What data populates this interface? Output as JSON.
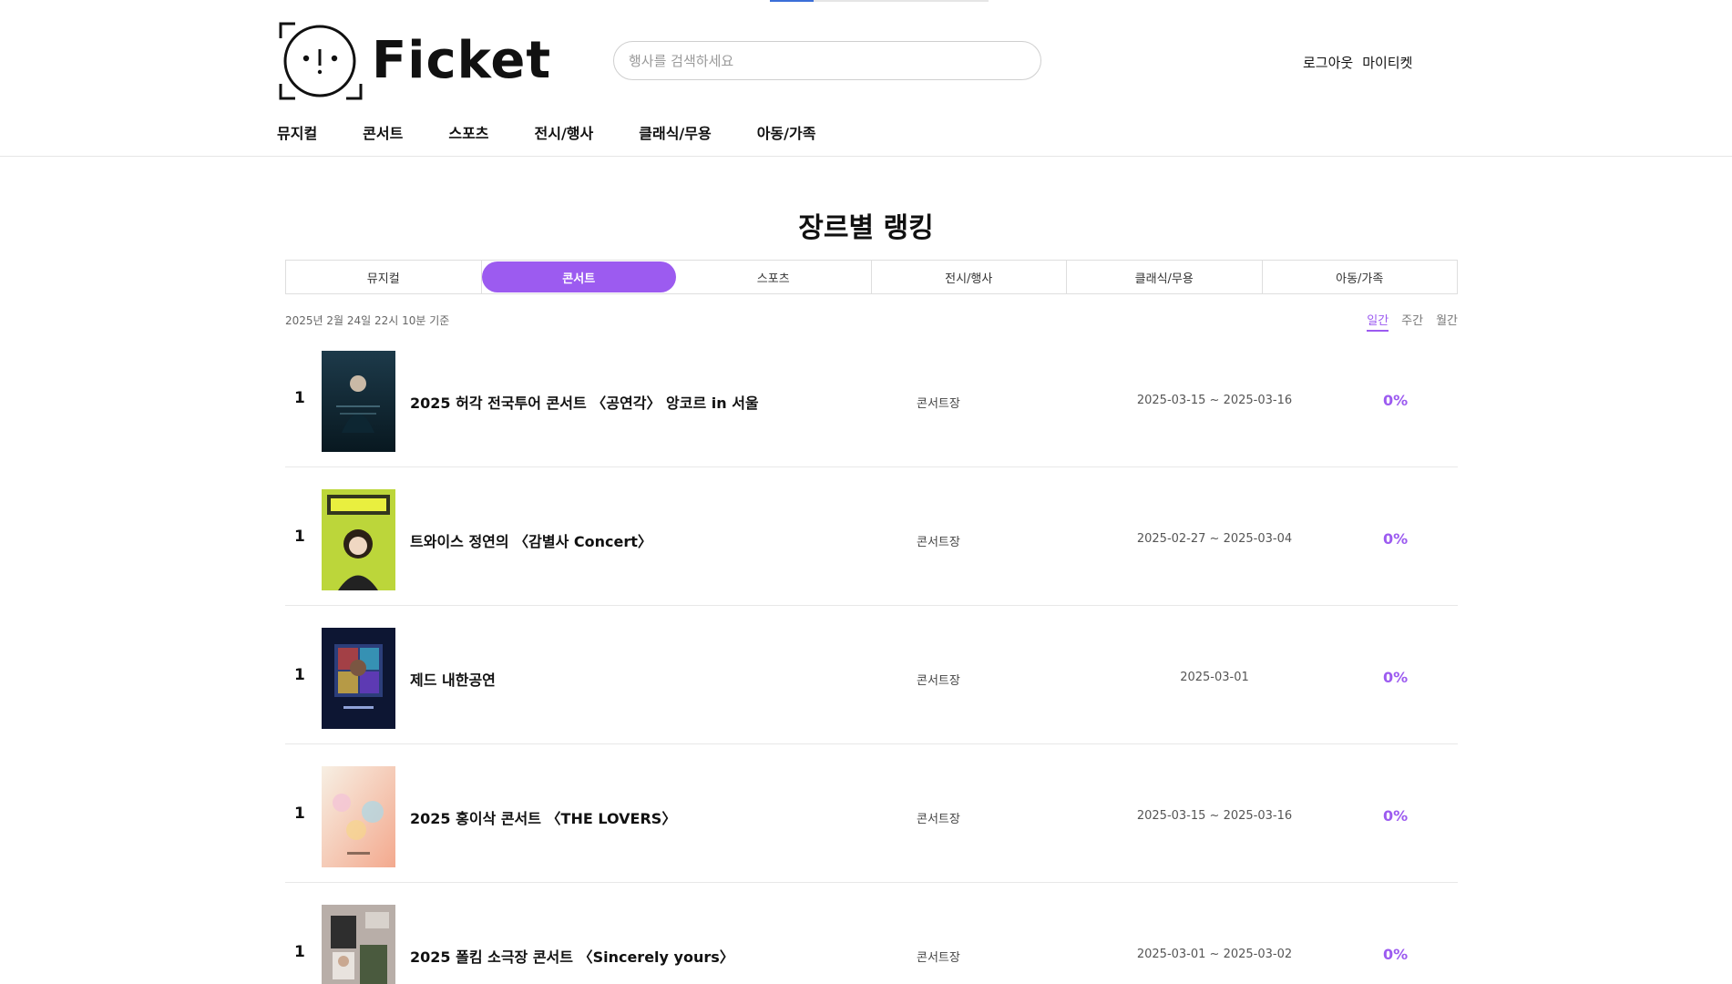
{
  "header": {
    "logo_text": "Ficket",
    "search_placeholder": "행사를 검색하세요",
    "logout": "로그아웃",
    "my_ticket": "마이티켓",
    "nav": [
      "뮤지컬",
      "콘서트",
      "스포츠",
      "전시/행사",
      "클래식/무용",
      "아동/가족"
    ]
  },
  "page": {
    "title": "장르별 랭킹",
    "genre_tabs": [
      "뮤지컬",
      "콘서트",
      "스포츠",
      "전시/행사",
      "클래식/무용",
      "아동/가족"
    ],
    "active_genre": "콘서트",
    "timestamp": "2025년 2월 24일 22시 10분 기준",
    "period_tabs": [
      "일간",
      "주간",
      "월간"
    ],
    "active_period": "일간"
  },
  "rankings": [
    {
      "rank": "1",
      "title": "2025 허각 전국투어 콘서트 〈공연각〉 앙코르 in 서울",
      "venue": "콘서트장",
      "date": "2025-03-15 ~ 2025-03-16",
      "rate": "0%"
    },
    {
      "rank": "1",
      "title": "트와이스 정연의 〈감별사 Concert〉",
      "venue": "콘서트장",
      "date": "2025-02-27 ~ 2025-03-04",
      "rate": "0%"
    },
    {
      "rank": "1",
      "title": "제드 내한공연",
      "venue": "콘서트장",
      "date": "2025-03-01",
      "rate": "0%"
    },
    {
      "rank": "1",
      "title": "2025 홍이삭 콘서트 〈THE LOVERS〉",
      "venue": "콘서트장",
      "date": "2025-03-15 ~ 2025-03-16",
      "rate": "0%"
    },
    {
      "rank": "1",
      "title": "2025 폴킴 소극장 콘서트 〈Sincerely yours〉",
      "venue": "콘서트장",
      "date": "2025-03-01 ~ 2025-03-02",
      "rate": "0%"
    }
  ],
  "colors": {
    "accent": "#9c5bf0",
    "divider": "#e8e8e8",
    "indicator": "#3b6fd8"
  }
}
